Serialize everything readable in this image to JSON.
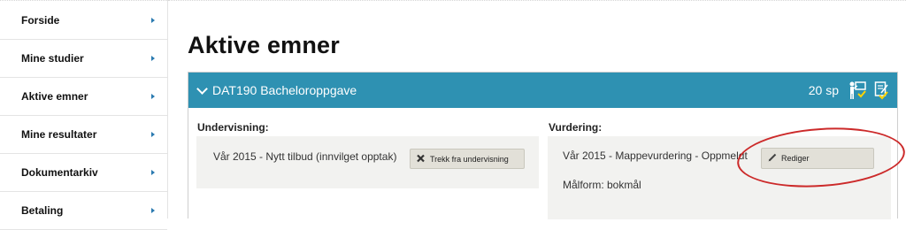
{
  "sidebar": {
    "items": [
      {
        "label": "Forside"
      },
      {
        "label": "Mine studier"
      },
      {
        "label": "Aktive emner"
      },
      {
        "label": "Mine resultater"
      },
      {
        "label": "Dokumentarkiv"
      },
      {
        "label": "Betaling"
      }
    ]
  },
  "main": {
    "title": "Aktive emner",
    "course": {
      "title": "DAT190 Bacheloroppgave",
      "credits": "20 sp",
      "teaching": {
        "label": "Undervisning:",
        "entry": "Vår 2015 - Nytt tilbud (innvilget opptak)",
        "button_label": "Trekk fra undervisning"
      },
      "assessment": {
        "label": "Vurdering:",
        "entry": "Vår 2015 - Mappevurdering - Oppmeldt",
        "language": "Målform: bokmål",
        "button_label": "Rediger"
      }
    }
  },
  "colors": {
    "header_bg": "#2e91b2",
    "nav_arrow": "#2a7ab0",
    "highlight_ellipse": "#cc2a2a"
  }
}
